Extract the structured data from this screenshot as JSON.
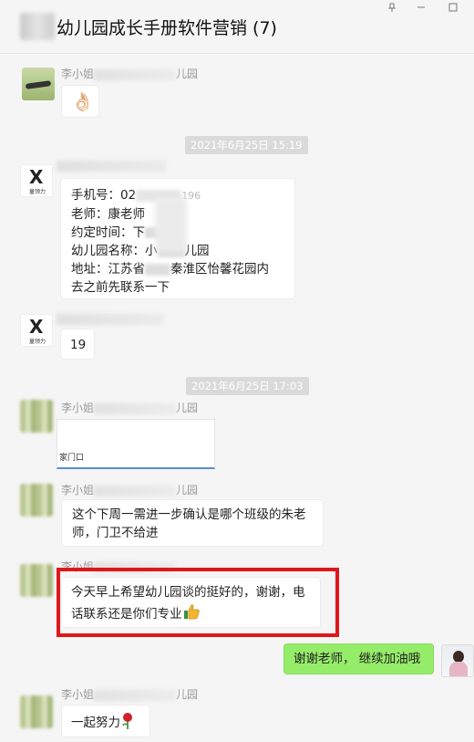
{
  "window": {
    "title": "幼儿园成长手册软件营销 (7)"
  },
  "messages": {
    "m1": {
      "sender": "李小姐",
      "sender_suffix": "儿园",
      "emoji": "👌🏻"
    },
    "t1": "2021年6月25日  15:19",
    "m2": {
      "lines": [
        "手机号：02",
        "老师：康老师",
        "约定时间：下",
        "幼儿园名称：小",
        "儿园",
        "地址：江苏省",
        "秦淮区怡馨花园内",
        "去之前先联系一下"
      ],
      "phone_tail": "196",
      "avatar_text": "童领力"
    },
    "m3": {
      "text": "19"
    },
    "t2": "2021年6月25日  17:03",
    "m4": {
      "sender": "李小姐",
      "sender_suffix": "儿园",
      "card_text": "家门口"
    },
    "m5": {
      "sender": "李小姐",
      "sender_suffix": "儿园",
      "text": "这个下周一需进一步确认是哪个班级的朱老师，门卫不给进"
    },
    "m6": {
      "sender": "李小姐",
      "sender_suffix": "",
      "text": "今天早上希望幼儿园谈的挺好的，谢谢，电话联系还是你们专业"
    },
    "m7": {
      "text": "谢谢老师， 继续加油哦"
    },
    "m8": {
      "sender": "李小姐",
      "sender_suffix": "儿园",
      "text": "一起努力"
    }
  },
  "colors": {
    "bubble_mine": "#95ec69",
    "highlight": "#e0161a",
    "timestamp_bg": "#dadada"
  }
}
